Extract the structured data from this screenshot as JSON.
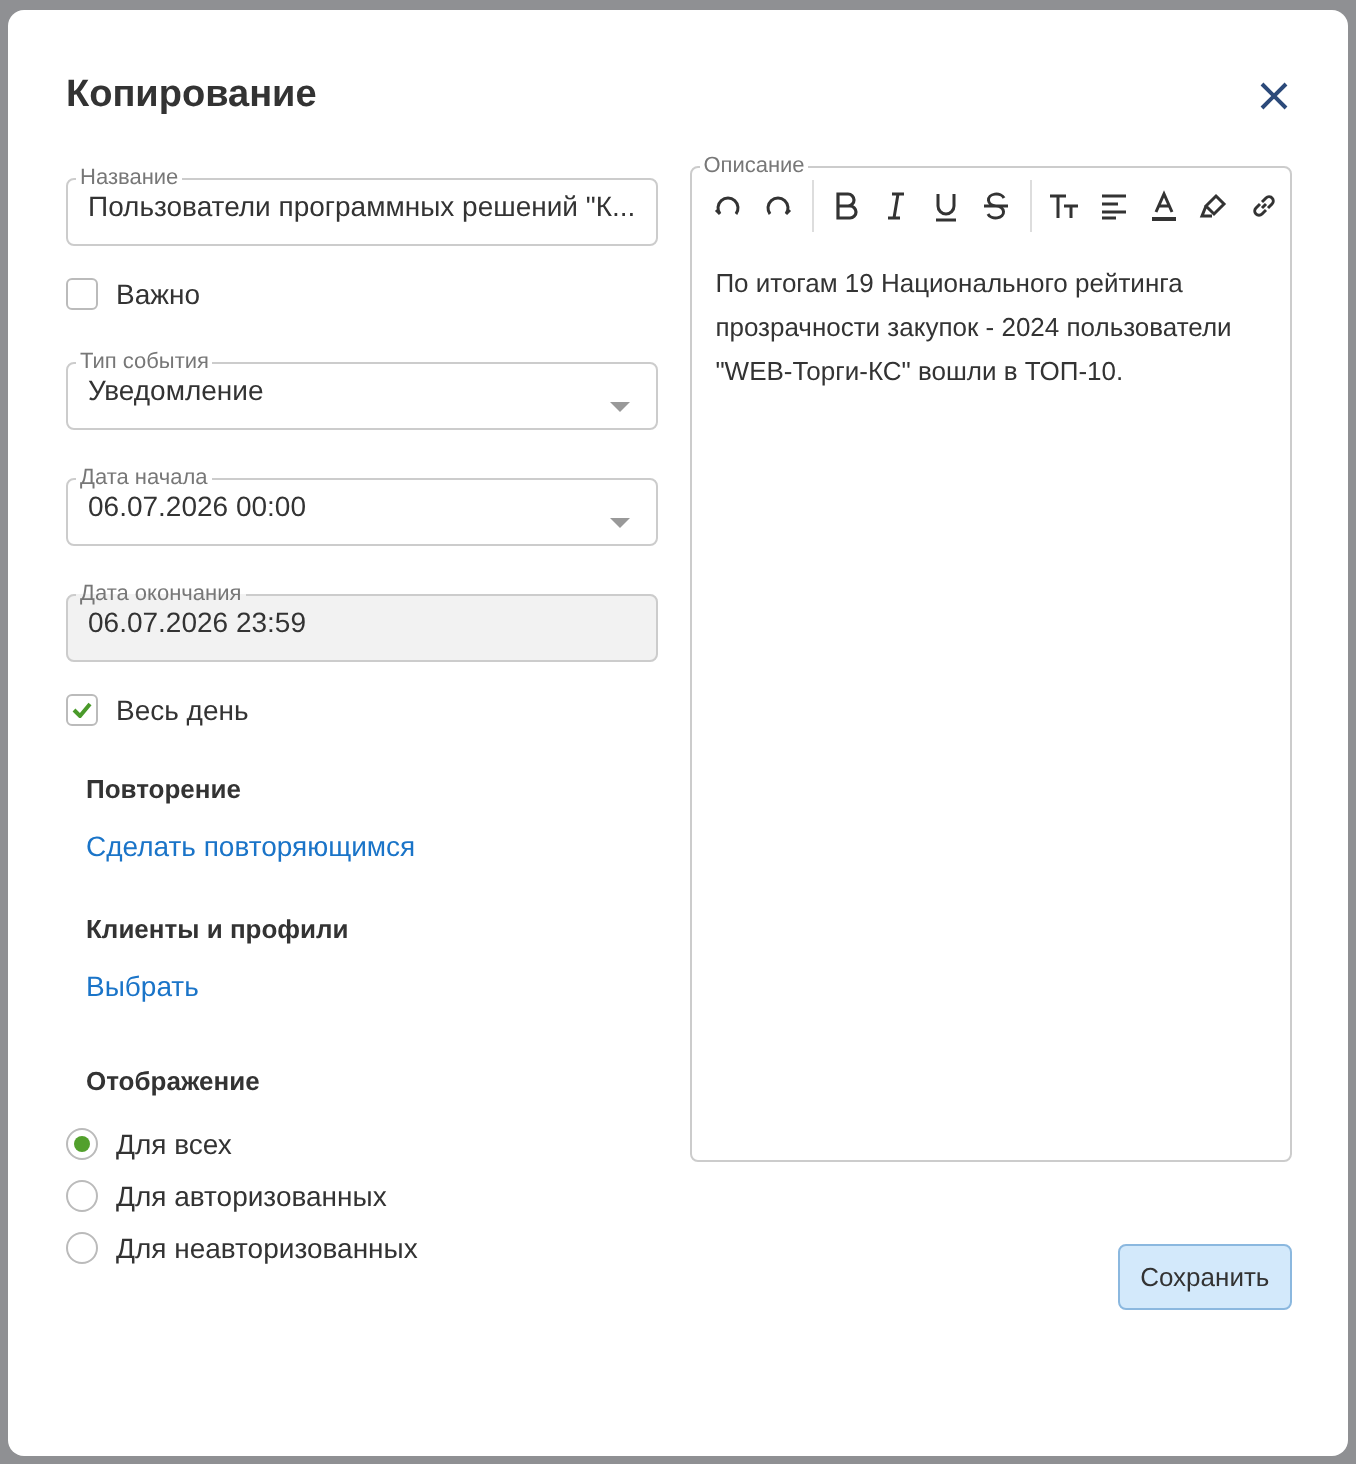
{
  "dialog": {
    "title": "Копирование"
  },
  "fields": {
    "name": {
      "label": "Название",
      "value": "Пользователи программных решений \"К..."
    },
    "important": {
      "label": "Важно",
      "checked": false
    },
    "event_type": {
      "label": "Тип события",
      "value": "Уведомление"
    },
    "start_date": {
      "label": "Дата начала",
      "value": "06.07.2026 00:00"
    },
    "end_date": {
      "label": "Дата окончания",
      "value": "06.07.2026 23:59",
      "disabled": true
    },
    "all_day": {
      "label": "Весь день",
      "checked": true
    }
  },
  "repeat": {
    "heading": "Повторение",
    "link": "Сделать повторяющимся"
  },
  "clients": {
    "heading": "Клиенты и профили",
    "link": "Выбрать"
  },
  "display": {
    "heading": "Отображение",
    "options": [
      {
        "label": "Для всех",
        "selected": true
      },
      {
        "label": "Для авторизованных",
        "selected": false
      },
      {
        "label": "Для неавторизованных",
        "selected": false
      }
    ]
  },
  "description": {
    "label": "Описание",
    "text": "По итогам 19 Национального рейтинга прозрачности закупок - 2024 пользователи \"WEB-Торги-КС\" вошли в ТОП-10."
  },
  "toolbar": [
    {
      "kind": "undo"
    },
    {
      "kind": "redo"
    },
    {
      "kind": "sep"
    },
    {
      "kind": "bold"
    },
    {
      "kind": "italic"
    },
    {
      "kind": "underline"
    },
    {
      "kind": "strike"
    },
    {
      "kind": "sep"
    },
    {
      "kind": "size"
    },
    {
      "kind": "align"
    },
    {
      "kind": "color"
    },
    {
      "kind": "highlight"
    },
    {
      "kind": "link"
    }
  ],
  "save_button": "Сохранить"
}
